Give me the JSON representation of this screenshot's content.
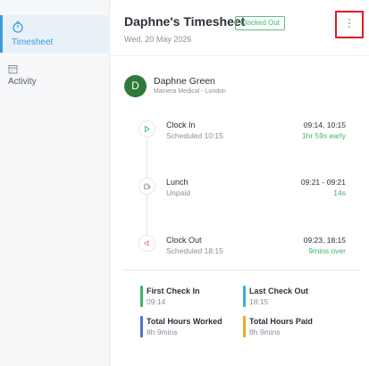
{
  "sidebar": {
    "items": [
      {
        "label": "Timesheet",
        "icon": "stopwatch-icon",
        "active": true
      },
      {
        "label": "Activity",
        "icon": "calendar-icon",
        "active": false
      }
    ]
  },
  "header": {
    "title": "Daphne's Timesheet",
    "status": "Clocked Out",
    "date": "Wed, 20 May 2026",
    "more_icon": "more-vertical-icon"
  },
  "employee": {
    "initial": "D",
    "name": "Daphne Green",
    "org": "Maniera Medical - London"
  },
  "timeline": [
    {
      "title": "Clock In",
      "subtitle": "Scheduled 10:15",
      "time": "09:14, 10:15",
      "delta": "1hr 59s early",
      "icon": "play-icon"
    },
    {
      "title": "Lunch",
      "subtitle": "Unpaid",
      "time": "09:21 - 09:21",
      "delta": "14s",
      "icon": "coffee-icon"
    },
    {
      "title": "Clock Out",
      "subtitle": "Scheduled 18:15",
      "time": "09:23, 18:15",
      "delta": "9mins over",
      "icon": "stop-icon"
    }
  ],
  "summary": {
    "first_check_in": {
      "label": "First Check In",
      "value": "09:14"
    },
    "last_check_out": {
      "label": "Last Check Out",
      "value": "18:15"
    },
    "total_worked": {
      "label": "Total Hours Worked",
      "value": "8h 9mins"
    },
    "total_paid": {
      "label": "Total Hours Paid",
      "value": "8h 9mins"
    }
  },
  "colors": {
    "accent": "#3a9bd9",
    "success": "#3fb56b",
    "avatar": "#2f7a3a",
    "bar_first_check_in": "#3fb56b",
    "bar_last_check_out": "#3ab0d9",
    "bar_total_worked": "#4a6fd0",
    "bar_total_paid": "#f0a81e"
  }
}
